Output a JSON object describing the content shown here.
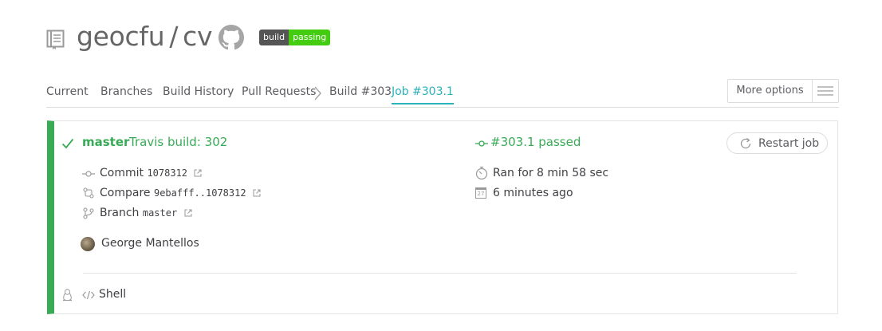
{
  "repo": {
    "owner": "geocfu",
    "separator": "/",
    "name": "cv"
  },
  "badge": {
    "left": "build",
    "right": "passing"
  },
  "tabs": [
    {
      "label": "Current"
    },
    {
      "label": "Branches"
    },
    {
      "label": "Build History"
    },
    {
      "label": "Pull Requests"
    },
    {
      "label": "Build #303"
    },
    {
      "label": "Job #303.1",
      "active": true
    }
  ],
  "more_options": "More options",
  "job": {
    "branch": "master",
    "build_label": "Travis build: 302",
    "status": "#303.1 passed",
    "restart": "Restart job",
    "commit_label": "Commit",
    "commit_sha": "1078312",
    "compare_label": "Compare",
    "compare_range": "9ebafff..1078312",
    "branch_label": "Branch",
    "branch_value": "master",
    "duration": "Ran for 8 min 58 sec",
    "finished": "6 minutes ago",
    "calendar_day": "27",
    "author": "George Mantellos",
    "language": "Shell"
  },
  "colors": {
    "passed": "#39aa56",
    "active_tab": "#2ab1b9",
    "badge_green": "#44cc11"
  }
}
